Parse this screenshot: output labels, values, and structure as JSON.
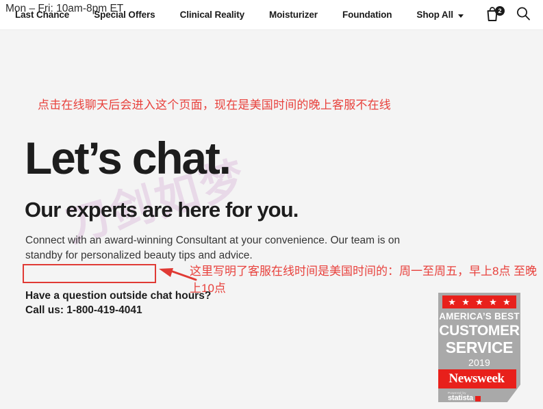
{
  "header": {
    "nav_items": [
      {
        "label": "Last Chance",
        "name": "nav-last-chance"
      },
      {
        "label": "Special Offers",
        "name": "nav-special-offers"
      },
      {
        "label": "Clinical Reality",
        "name": "nav-clinical-reality"
      },
      {
        "label": "Moisturizer",
        "name": "nav-moisturizer"
      },
      {
        "label": "Foundation",
        "name": "nav-foundation"
      }
    ],
    "shop_all_label": "Shop All",
    "cart_count": "2",
    "cart_icon": "shopping-bag-icon",
    "search_icon": "search-icon"
  },
  "annotations": {
    "top_note": "点击在线聊天后会进入这个页面，现在是美国时间的晚上客服不在线",
    "hours_note": "这里写明了客服在线时间是美国时间的：周一至周五，早上8点 至晚上10点",
    "arrow_icon": "left-arrow-icon",
    "accent_color": "#e8413c"
  },
  "main": {
    "title": "Let’s chat.",
    "subtitle": "Our experts are here for you.",
    "body": "Connect with an award-winning Consultant at your convenience. Our team is on standby for personalized beauty tips and advice.",
    "hours": "Mon – Fri: 10am-8pm ET",
    "hours_box_color": "#e03a34",
    "outside_hours_question": "Have a question outside chat hours?",
    "call_us": "Call us: 1-800-419-4041"
  },
  "watermark": {
    "text": "刀剑如梦"
  },
  "badge": {
    "stars": "★★★★★",
    "line1": "AMERICA’S BEST",
    "line2": "CUSTOMER",
    "line3": "SERVICE",
    "year": "2019",
    "brand": "Newsweek",
    "powered_by": "Powered by",
    "provider": "statista",
    "red": "#e8201b",
    "gray": "#a9a9a9"
  }
}
